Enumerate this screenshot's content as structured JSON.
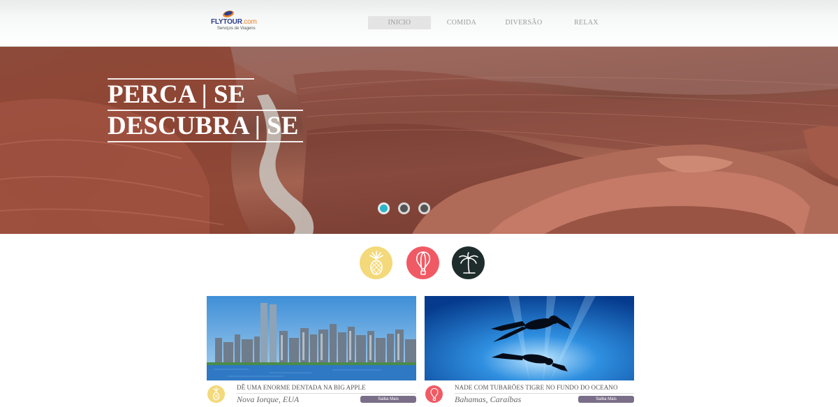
{
  "header": {
    "logo": {
      "brand": "FLYTOUR",
      "suffix": ".com",
      "tagline": "Serviços de Viagens"
    },
    "nav": [
      {
        "label": "INICIO",
        "active": true
      },
      {
        "label": "COMIDA",
        "active": false
      },
      {
        "label": "DIVERSÃO",
        "active": false
      },
      {
        "label": "RELAX",
        "active": false
      }
    ]
  },
  "hero": {
    "line1": "PERCA | SE",
    "line2": "DESCUBRA | SE",
    "slides": 3,
    "active_slide": 1,
    "colors": {
      "active_dot": "#29b6c8"
    }
  },
  "categories": [
    {
      "icon": "pineapple-icon",
      "color": "#f3d97a"
    },
    {
      "icon": "hot-air-balloon-icon",
      "color": "#f05a64"
    },
    {
      "icon": "palm-tree-icon",
      "color": "#1e2d2b"
    }
  ],
  "cards": [
    {
      "title": "DÊ UMA ENORME DENTADA NA BIG APPLE",
      "place": "Nova Iorque, EUA",
      "button": "Saiba Mais",
      "icon": "pineapple-icon",
      "icon_color": "#f3d97a"
    },
    {
      "title": "NADE COM TUBARÕES TIGRE NO FUNDO DO OCEANO",
      "place": "Bahamas, Caraíbas",
      "button": "Saiba Mais",
      "icon": "hot-air-balloon-icon",
      "icon_color": "#f05a64"
    }
  ]
}
